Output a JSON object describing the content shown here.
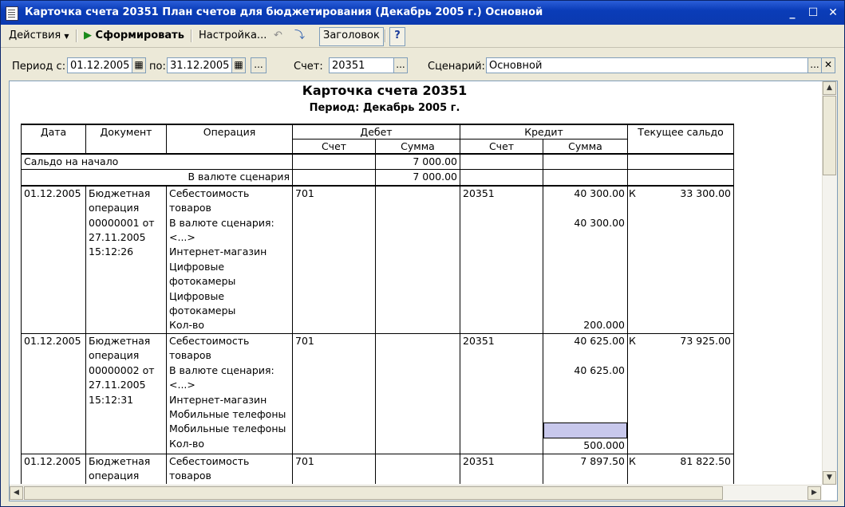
{
  "window": {
    "title": "Карточка счета 20351 План счетов для бюджетирования (Декабрь 2005 г.) Основной"
  },
  "toolbar": {
    "actions": "Действия",
    "generate": "Сформировать",
    "settings": "Настройка...",
    "header": "Заголовок",
    "help": "?"
  },
  "filters": {
    "period_from_label": "Период с:",
    "period_from": "01.12.2005",
    "period_to_label": "по:",
    "period_to": "31.12.2005",
    "account_label": "Счет:",
    "account": "20351",
    "scenario_label": "Сценарий:",
    "scenario": "Основной",
    "ellipsis": "..."
  },
  "report": {
    "title": "Карточка счета 20351",
    "subtitle": "Период: Декабрь 2005 г.",
    "headers": {
      "date": "Дата",
      "document": "Документ",
      "operation": "Операция",
      "debit": "Дебет",
      "credit": "Кредит",
      "balance": "Текущее сальдо",
      "account": "Счет",
      "amount": "Сумма"
    },
    "opening": {
      "label": "Сальдо на начало",
      "amount": "7 000.00",
      "scenario_label": "В валюте сценария",
      "scenario_amount": "7 000.00"
    },
    "rows": [
      {
        "date": "01.12.2005",
        "document": [
          "Бюджетная",
          "операция",
          "00000001 от",
          "27.11.2005",
          "15:12:26"
        ],
        "operation": [
          "Себестоимость",
          "товаров",
          "В валюте сценария:",
          "<...>",
          "Интернет-магазин",
          "Цифровые",
          "фотокамеры",
          "Цифровые",
          "фотокамеры",
          "Кол-во"
        ],
        "debit_account": "701",
        "credit_account": "20351",
        "credit_amounts": [
          "40 300.00",
          "",
          "40 300.00",
          "",
          "",
          "",
          "",
          "",
          "",
          "200.000"
        ],
        "balance_side": "К",
        "balance": "33 300.00"
      },
      {
        "date": "01.12.2005",
        "document": [
          "Бюджетная",
          "операция",
          "00000002 от",
          "27.11.2005",
          "15:12:31"
        ],
        "operation": [
          "Себестоимость",
          "товаров",
          "В валюте сценария:",
          "<...>",
          "Интернет-магазин",
          "Мобильные телефоны",
          "Мобильные телефоны",
          "Кол-во"
        ],
        "debit_account": "701",
        "credit_account": "20351",
        "credit_amounts": [
          "40 625.00",
          "",
          "40 625.00",
          "",
          "",
          "",
          "",
          "500.000"
        ],
        "balance_side": "К",
        "balance": "73 925.00"
      },
      {
        "date": "01.12.2005",
        "document": [
          "Бюджетная",
          "операция"
        ],
        "operation": [
          "Себестоимость",
          "товаров"
        ],
        "debit_account": "701",
        "credit_account": "20351",
        "credit_amounts": [
          "7 897.50",
          ""
        ],
        "balance_side": "К",
        "balance": "81 822.50"
      }
    ]
  }
}
